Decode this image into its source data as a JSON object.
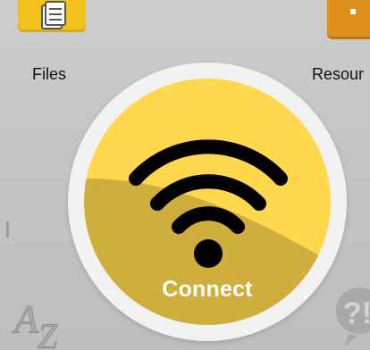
{
  "tiles": {
    "files": {
      "label": "Files",
      "icon": "document-icon",
      "color": "#f1c21b"
    },
    "resources": {
      "label": "Resour",
      "icon": "folder-icon",
      "color": "#e08f1a"
    }
  },
  "connect": {
    "label": "Connect",
    "icon": "wifi-icon",
    "color_top": "#ffd84d",
    "color_bottom": "#cfae3b"
  },
  "bottom_icons": {
    "left": "a-z-icon",
    "right": "help-icon"
  }
}
